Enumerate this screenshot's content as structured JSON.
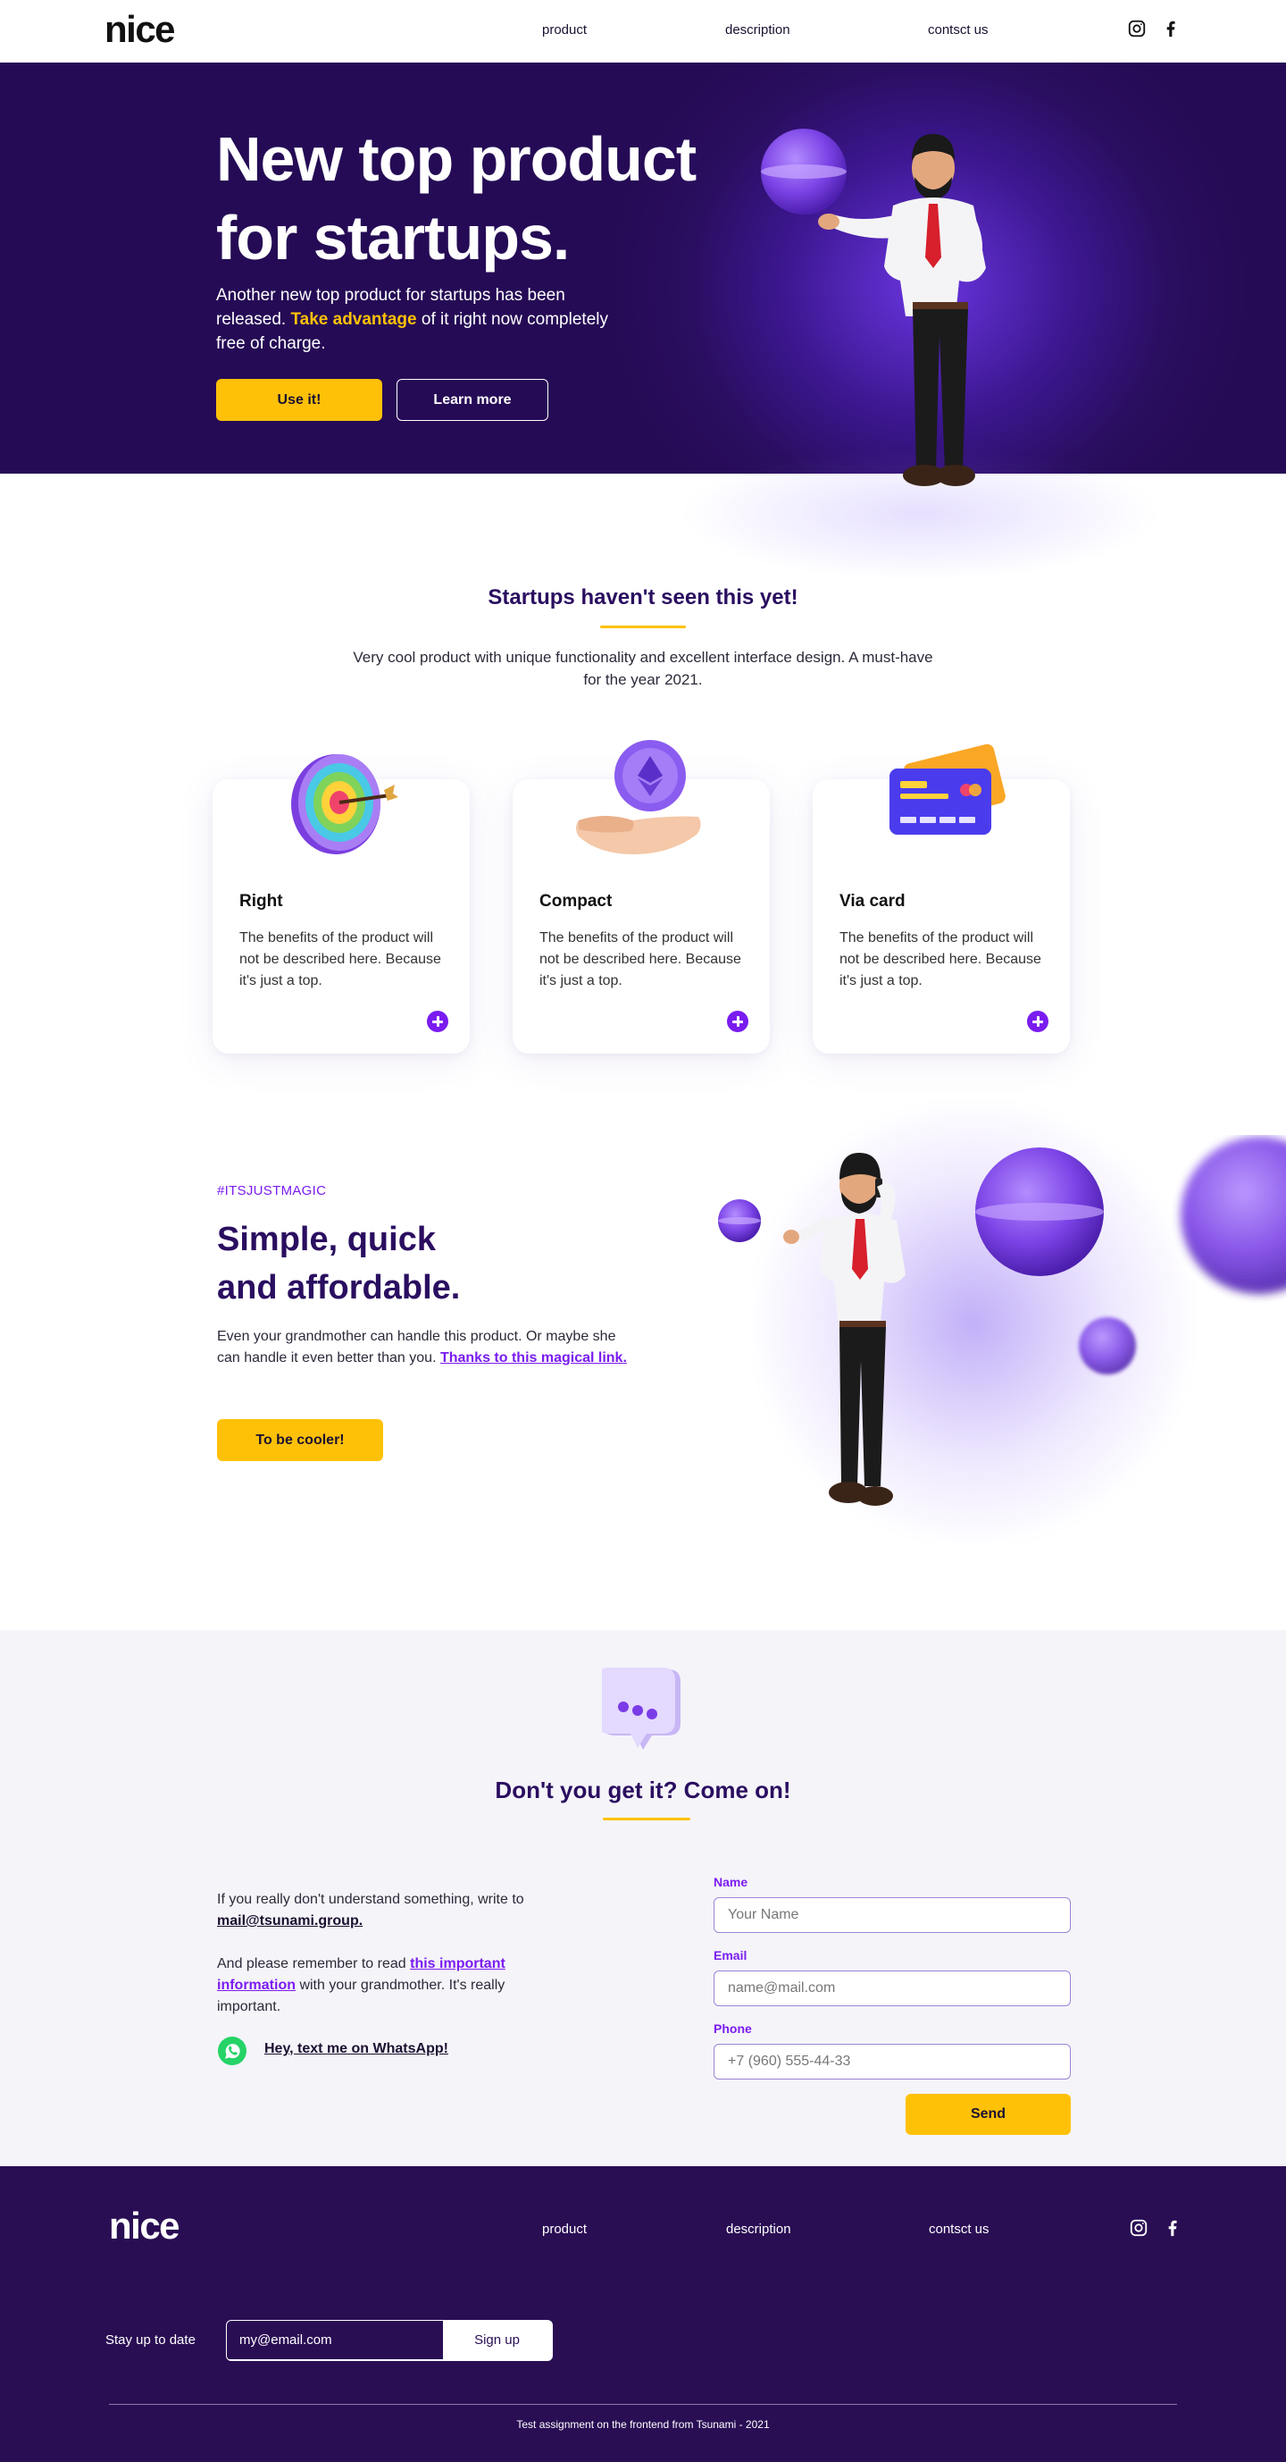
{
  "header": {
    "logo": "nice",
    "nav": [
      "product",
      "description",
      "contsct us"
    ],
    "social": [
      "instagram-icon",
      "facebook-icon"
    ]
  },
  "hero": {
    "title_line1": "New top product",
    "title_line2": "for startups.",
    "text_before": "Another new top product for startups has been released. ",
    "text_highlight": "Take advantage",
    "text_after": " of it right now completely free of charge.",
    "primary_button": "Use it!",
    "secondary_button": "Learn more"
  },
  "features": {
    "title": "Startups haven't seen this yet!",
    "subtitle": "Very cool product with unique functionality and excellent interface design. A must-have for the year 2021.",
    "cards": [
      {
        "title": "Right",
        "text": "The benefits of the product will not be described here. Because it's just a top.",
        "icon": "target-icon"
      },
      {
        "title": "Compact",
        "text": "The benefits of the product will not be described here. Because it's just a top.",
        "icon": "coin-hand-icon"
      },
      {
        "title": "Via card",
        "text": "The benefits of the product will not be described here. Because it's just a top.",
        "icon": "credit-card-icon"
      }
    ]
  },
  "magic": {
    "tag": "#ITSJUSTMAGIC",
    "title_line1": "Simple, quick",
    "title_line2": "and affordable.",
    "text_before": "Even your grandmother can handle this product. Or maybe she can handle it even better than you. ",
    "text_link": "Thanks to this magical link.",
    "button": "To be cooler!"
  },
  "contact": {
    "title": "Don't you get it? Come on!",
    "text1": "If you really don't understand something, write to",
    "email": "mail@tsunami.group.",
    "text2_before": "And please remember to read ",
    "text2_link": "this important information",
    "text2_after": " with your grandmother.  It's really important.",
    "whatsapp": "Hey, text me on WhatsApp!",
    "form": {
      "name_label": "Name",
      "name_placeholder": "Your Name",
      "email_label": "Email",
      "email_placeholder": "name@mail.com",
      "phone_label": "Phone",
      "phone_placeholder": "+7 (960) 555-44-33",
      "submit": "Send"
    }
  },
  "footer": {
    "logo": "nice",
    "nav": [
      "product",
      "description",
      "contsct us"
    ],
    "subscribe_label": "Stay up to date",
    "subscribe_placeholder": "my@email.com",
    "subscribe_button": "Sign up",
    "copyright": "Test assignment on the frontend from Tsunami - 2021"
  },
  "colors": {
    "brand_dark": "#2a0e60",
    "accent_yellow": "#ffc107",
    "accent_purple": "#7a1cf0"
  }
}
